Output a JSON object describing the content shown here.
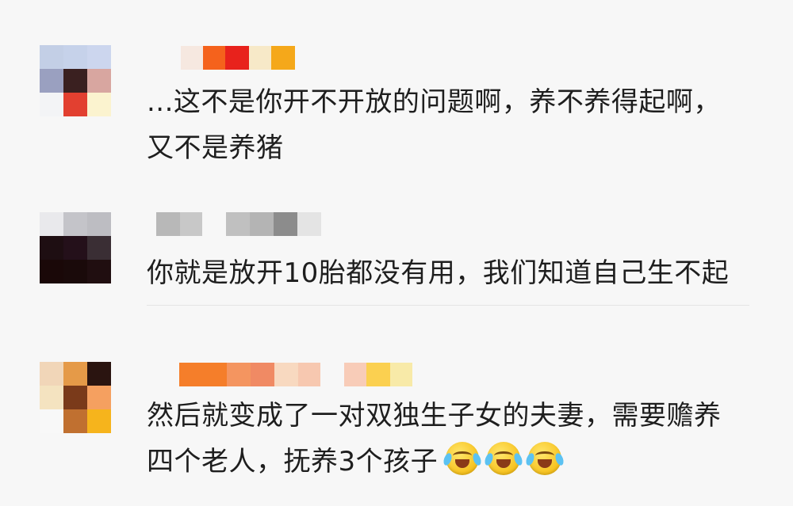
{
  "comments": [
    {
      "text_lines": [
        "...这不是你开不开放的问题啊，养不养得起啊，",
        "又不是养猪"
      ],
      "avatar_colors": [
        "#c3cfe6",
        "#c6d2ea",
        "#ccd6ee",
        "#9aa0c0",
        "#3a2020",
        "#d8a6a0",
        "#f3f4f6",
        "#e24030",
        "#fbf3cf"
      ],
      "name_colors": [
        "#f6e8e0",
        "#f5621c",
        "#e8221c",
        "#f7e9c8",
        "#f5a81a"
      ]
    },
    {
      "text_lines": [
        "你就是放开10胎都没有用，我们知道自己生不起"
      ],
      "avatar_colors": [
        "#e9e9ec",
        "#c4c4c9",
        "#bdbdc2",
        "#1e0e12",
        "#24101a",
        "#3a2e34",
        "#1a0808",
        "#1a0a0a",
        "#200e10"
      ],
      "name_colors": [
        "#b8b8b8",
        "#c8c8c8",
        "#f7f7f7",
        "#c0c0c0",
        "#b4b4b4",
        "#8c8c8c",
        "#e4e4e4"
      ]
    },
    {
      "text_lines": [
        "然后就变成了一对双独生子女的夫妻，需要赡养",
        "四个老人，抚养3个孩子"
      ],
      "emoji_icons": [
        "laugh-cry-emoji",
        "laugh-cry-emoji",
        "laugh-cry-emoji"
      ],
      "avatar_colors": [
        "#f1d6b8",
        "#e59a48",
        "#2a1410",
        "#f4e3c0",
        "#7a3a1a",
        "#f5a060",
        "#f8f8f8",
        "#c07030",
        "#f6b41c"
      ],
      "name_colors": [
        "#f57e2a",
        "#f49560",
        "#f08a64",
        "#f8d9c0",
        "#f7c8b0",
        "#f7f7f7",
        "#f8ccb8",
        "#fbd050",
        "#f8eaa8"
      ]
    }
  ]
}
